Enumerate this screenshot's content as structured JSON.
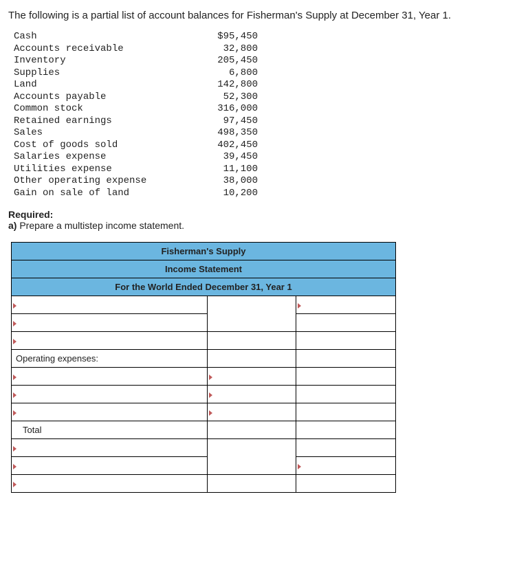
{
  "intro": "The following is a partial list of account balances for Fisherman's Supply at December 31, Year 1.",
  "balances": [
    {
      "label": "Cash",
      "amt": "$95,450"
    },
    {
      "label": "Accounts receivable",
      "amt": "32,800"
    },
    {
      "label": "Inventory",
      "amt": "205,450"
    },
    {
      "label": "Supplies",
      "amt": "6,800"
    },
    {
      "label": "Land",
      "amt": "142,800"
    },
    {
      "label": "Accounts payable",
      "amt": "52,300"
    },
    {
      "label": "Common stock",
      "amt": "316,000"
    },
    {
      "label": "Retained earnings",
      "amt": "97,450"
    },
    {
      "label": "Sales",
      "amt": "498,350"
    },
    {
      "label": "Cost of goods sold",
      "amt": "402,450"
    },
    {
      "label": "Salaries expense",
      "amt": "39,450"
    },
    {
      "label": "Utilities expense",
      "amt": "11,100"
    },
    {
      "label": "Other operating expense",
      "amt": "38,000"
    },
    {
      "label": "Gain on sale of land",
      "amt": "10,200"
    }
  ],
  "required_label": "Required:",
  "required_a": "a) Prepare a multistep income statement.",
  "stmt": {
    "header1": "Fisherman's Supply",
    "header2": "Income Statement",
    "header3": "For the World Ended December 31, Year 1",
    "operating_expenses_label": "Operating expenses:",
    "total_label": "Total"
  }
}
